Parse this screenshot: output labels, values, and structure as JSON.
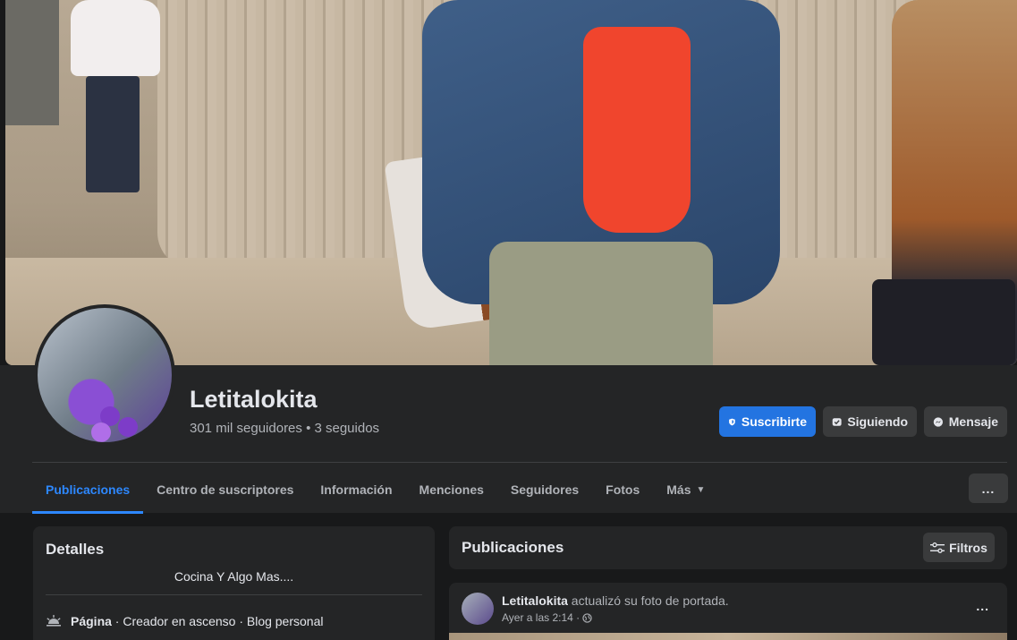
{
  "profile": {
    "name": "Letitalokita",
    "stats": "301 mil seguidores • 3 seguidos"
  },
  "actions": {
    "subscribe": "Suscribirte",
    "following": "Siguiendo",
    "message": "Mensaje"
  },
  "tabs": [
    {
      "label": "Publicaciones",
      "active": true
    },
    {
      "label": "Centro de suscriptores"
    },
    {
      "label": "Información"
    },
    {
      "label": "Menciones"
    },
    {
      "label": "Seguidores"
    },
    {
      "label": "Fotos"
    },
    {
      "label": "Más"
    }
  ],
  "more_menu": "...",
  "details": {
    "title": "Detalles",
    "bio": "Cocina Y Algo Mas....",
    "page_label": "Página",
    "page_rest": " · Creador en ascenso · Blog personal"
  },
  "posts_section": {
    "title": "Publicaciones",
    "filters": "Filtros"
  },
  "post": {
    "author": "Letitalokita",
    "action": " actualizó su foto de portada.",
    "time": "Ayer a las 2:14 ·",
    "more": "..."
  },
  "colors": {
    "accent": "#2374e1",
    "active_tab": "#2d88ff",
    "background": "#18191a",
    "card": "#242526"
  }
}
